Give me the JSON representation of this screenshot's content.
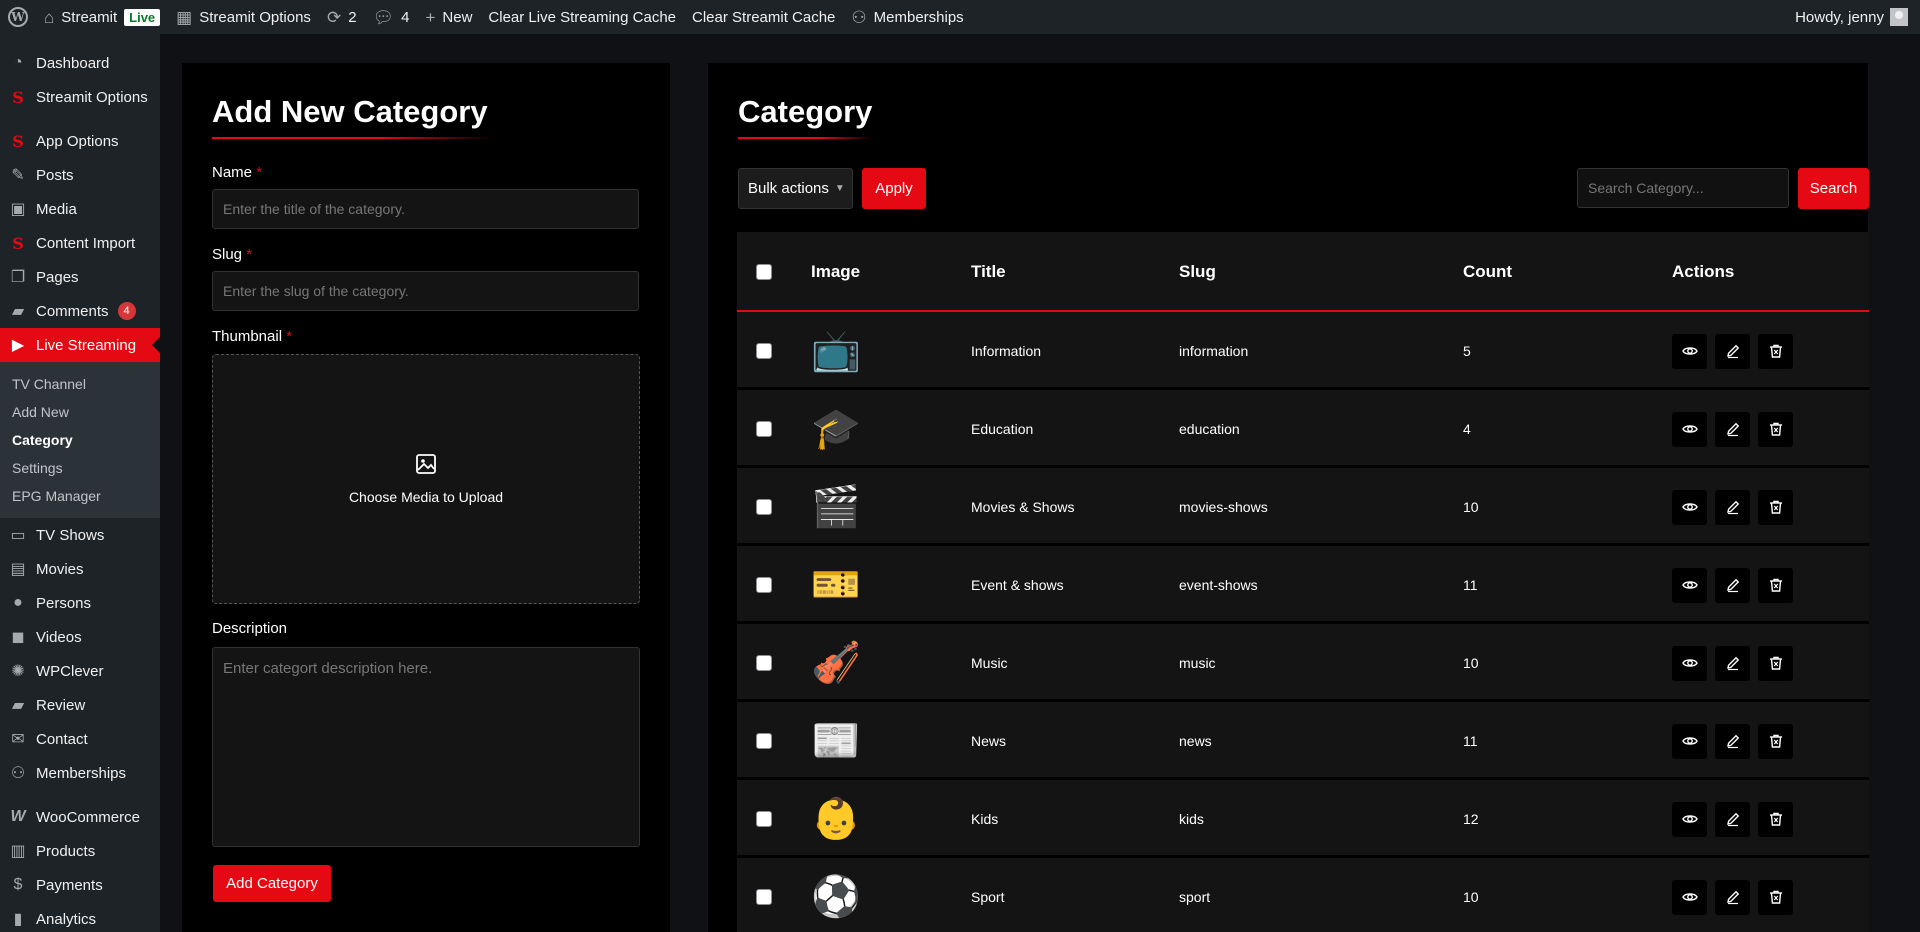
{
  "adminbar": {
    "site_name": "Streamit",
    "live_label": "Live",
    "options_label": "Streamit Options",
    "updates_count": "2",
    "comments_count": "4",
    "new_label": "New",
    "clear_live_cache": "Clear Live Streaming Cache",
    "clear_streamit_cache": "Clear Streamit Cache",
    "memberships": "Memberships",
    "howdy": "Howdy, jenny"
  },
  "sidebar": {
    "items": [
      {
        "label": "Dashboard",
        "icon": "dashboard-icon"
      },
      {
        "label": "Streamit Options",
        "icon": "streamit-icon"
      },
      {
        "label": "App Options",
        "icon": "streamit-icon"
      },
      {
        "label": "Posts",
        "icon": "pin-icon"
      },
      {
        "label": "Media",
        "icon": "media-icon"
      },
      {
        "label": "Content Import",
        "icon": "streamit-icon"
      },
      {
        "label": "Pages",
        "icon": "pages-icon"
      },
      {
        "label": "Comments",
        "icon": "comment-icon",
        "badge": "4"
      },
      {
        "label": "Live Streaming",
        "icon": "video-icon"
      },
      {
        "label": "TV Shows",
        "icon": "tv-icon"
      },
      {
        "label": "Movies",
        "icon": "film-icon"
      },
      {
        "label": "Persons",
        "icon": "person-icon"
      },
      {
        "label": "Videos",
        "icon": "camera-icon"
      },
      {
        "label": "WPClever",
        "icon": "bulb-icon"
      },
      {
        "label": "Review",
        "icon": "comment-icon"
      },
      {
        "label": "Contact",
        "icon": "mail-icon"
      },
      {
        "label": "Memberships",
        "icon": "group-icon"
      },
      {
        "label": "WooCommerce",
        "icon": "woo-icon"
      },
      {
        "label": "Products",
        "icon": "archive-icon"
      },
      {
        "label": "Payments",
        "icon": "dollar-icon"
      },
      {
        "label": "Analytics",
        "icon": "chart-icon"
      }
    ],
    "submenu": [
      "TV Channel",
      "Add New",
      "Category",
      "Settings",
      "EPG Manager"
    ]
  },
  "form": {
    "heading": "Add New Category",
    "name_label": "Name",
    "name_placeholder": "Enter the title of the category.",
    "slug_label": "Slug",
    "slug_placeholder": "Enter the slug of the category.",
    "thumbnail_label": "Thumbnail",
    "upload_text": "Choose Media to Upload",
    "description_label": "Description",
    "description_placeholder": "Enter categort description here.",
    "submit_label": "Add Category",
    "required_mark": "*"
  },
  "list": {
    "heading": "Category",
    "bulk_actions": "Bulk actions",
    "apply_label": "Apply",
    "search_placeholder": "Search Category...",
    "search_label": "Search",
    "columns": [
      "Image",
      "Title",
      "Slug",
      "Count",
      "Actions"
    ],
    "rows": [
      {
        "image": "📺",
        "title": "Information",
        "slug": "information",
        "count": "5"
      },
      {
        "image": "🎓",
        "title": "Education",
        "slug": "education",
        "count": "4"
      },
      {
        "image": "🎬",
        "title": "Movies & Shows",
        "slug": "movies-shows",
        "count": "10"
      },
      {
        "image": "🎫",
        "title": "Event & shows",
        "slug": "event-shows",
        "count": "11"
      },
      {
        "image": "🎻",
        "title": "Music",
        "slug": "music",
        "count": "10"
      },
      {
        "image": "📰",
        "title": "News",
        "slug": "news",
        "count": "11"
      },
      {
        "image": "👶",
        "title": "Kids",
        "slug": "kids",
        "count": "12"
      },
      {
        "image": "⚽",
        "title": "Sport",
        "slug": "sport",
        "count": "10"
      }
    ]
  },
  "colors": {
    "accent": "#e50914",
    "panel": "#000000",
    "row": "#141414"
  }
}
